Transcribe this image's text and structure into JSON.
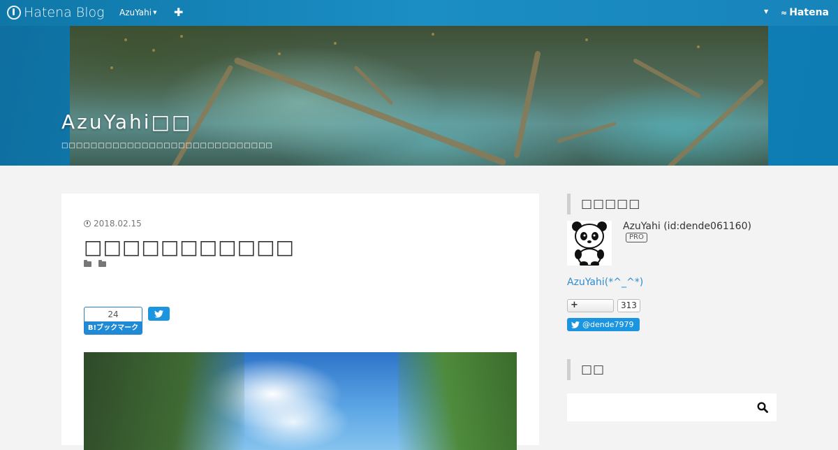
{
  "topbar": {
    "logo_text": "Hatena Blog",
    "user_menu_label": "AzuYahi",
    "add_icon": "plus-icon",
    "brand_text": "Hatena"
  },
  "header": {
    "blog_title": "AzuYahi□□",
    "blog_subtitle": "□□□□□□□□□□□□□□□□□□□□□□□□□□□□□"
  },
  "entry": {
    "date": "2018.02.15",
    "title": "□□□□□□□□□□□",
    "bookmark_count": "24",
    "bookmark_label": "B!ブックマーク"
  },
  "sidebar": {
    "profile_heading": "□□□□□",
    "profile_name": "AzuYahi (id:dende061160)",
    "pro_badge": "PRO",
    "profile_link": "AzuYahi(*^_^*)",
    "subscribe_label": "+",
    "subscribe_count": "313",
    "twitter_follow": "@dende7979",
    "search_heading": "□□"
  },
  "colors": {
    "accent": "#1b8ec4",
    "twitter": "#1b95e0",
    "link": "#2d8ccf"
  }
}
